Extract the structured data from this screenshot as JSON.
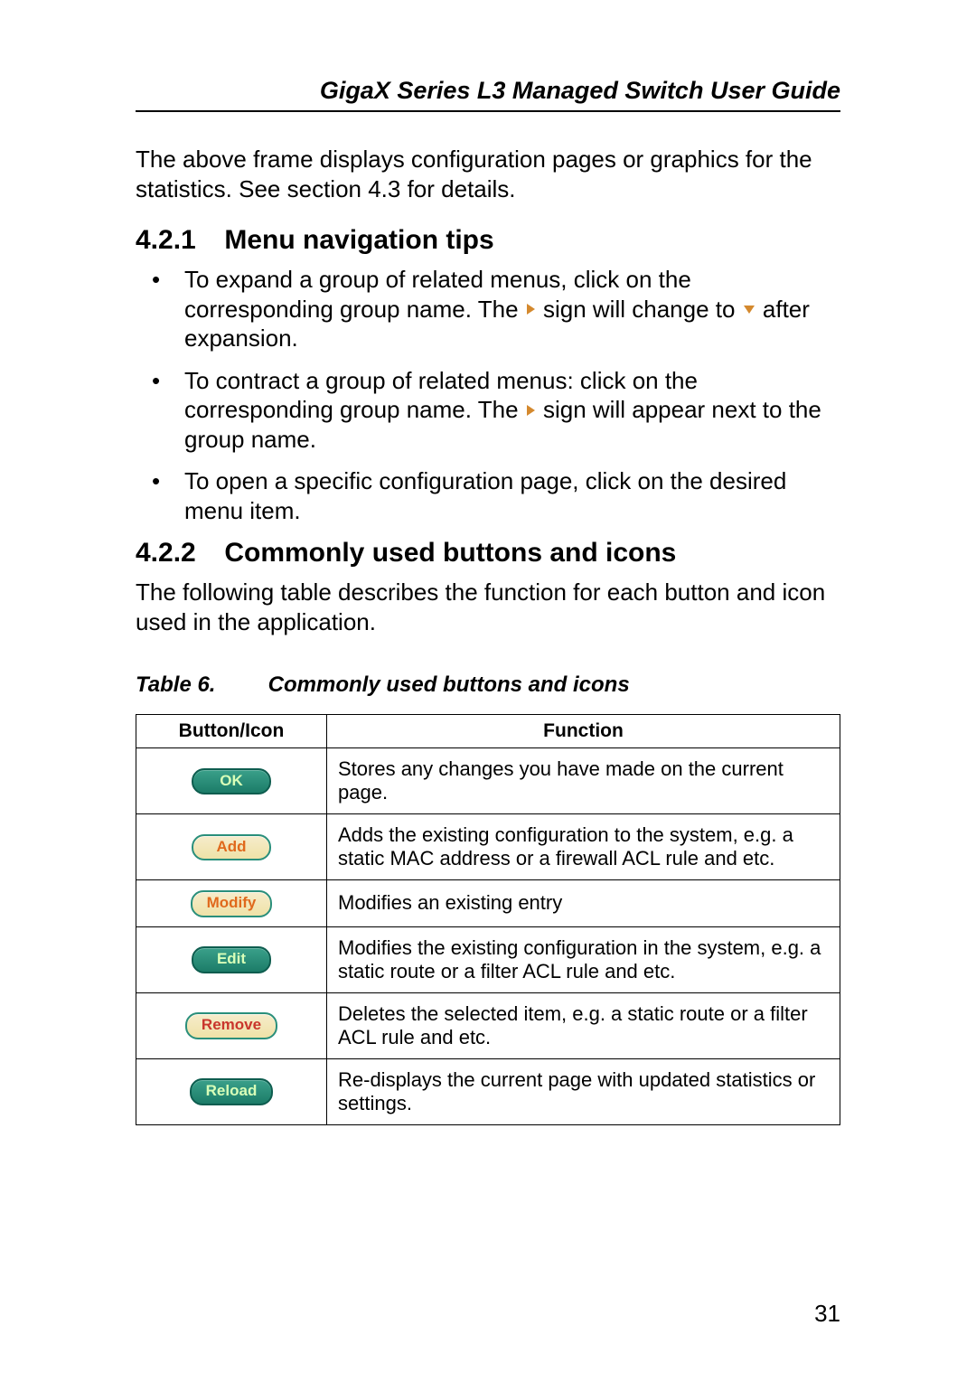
{
  "header": {
    "running_title": "GigaX Series L3 Managed Switch User Guide"
  },
  "intro_paragraph": "The above frame displays configuration pages or graphics for the statistics. See section 4.3 for details.",
  "section_421": {
    "number": "4.2.1",
    "title": "Menu navigation tips",
    "bullet1_a": "To expand a group of related menus, click on the corresponding group name. The ",
    "bullet1_b": " sign will change to ",
    "bullet1_c": " after expansion.",
    "bullet2_a": "To contract a group of related menus: click on the corresponding group name. The ",
    "bullet2_b": " sign will appear next to the group name.",
    "bullet3": "To open a specific configuration page, click on the desired menu item."
  },
  "section_422": {
    "number": "4.2.2",
    "title": "Commonly used buttons and icons",
    "intro": "The following table describes the function for each button and icon used in the application."
  },
  "table_caption": {
    "label": "Table 6.",
    "text": "Commonly used buttons and icons"
  },
  "table_headers": {
    "icon": "Button/Icon",
    "function": "Function"
  },
  "table_rows": [
    {
      "button_label": "OK",
      "style": "green",
      "function": "Stores any changes you have made on the current page."
    },
    {
      "button_label": "Add",
      "style": "beige-orange",
      "function": "Adds the existing configuration to the system, e.g. a static MAC address or a firewall ACL rule and etc."
    },
    {
      "button_label": "Modify",
      "style": "beige-orange",
      "function": "Modifies an existing entry"
    },
    {
      "button_label": "Edit",
      "style": "green",
      "function": "Modifies the existing configuration in the system, e.g. a static route or a filter ACL rule and etc."
    },
    {
      "button_label": "Remove",
      "style": "beige-red",
      "function": "Deletes the selected item, e.g. a static route or a filter ACL rule and etc."
    },
    {
      "button_label": "Reload",
      "style": "green",
      "function": "Re-displays the current page with updated statistics or settings."
    }
  ],
  "page_number": "31"
}
